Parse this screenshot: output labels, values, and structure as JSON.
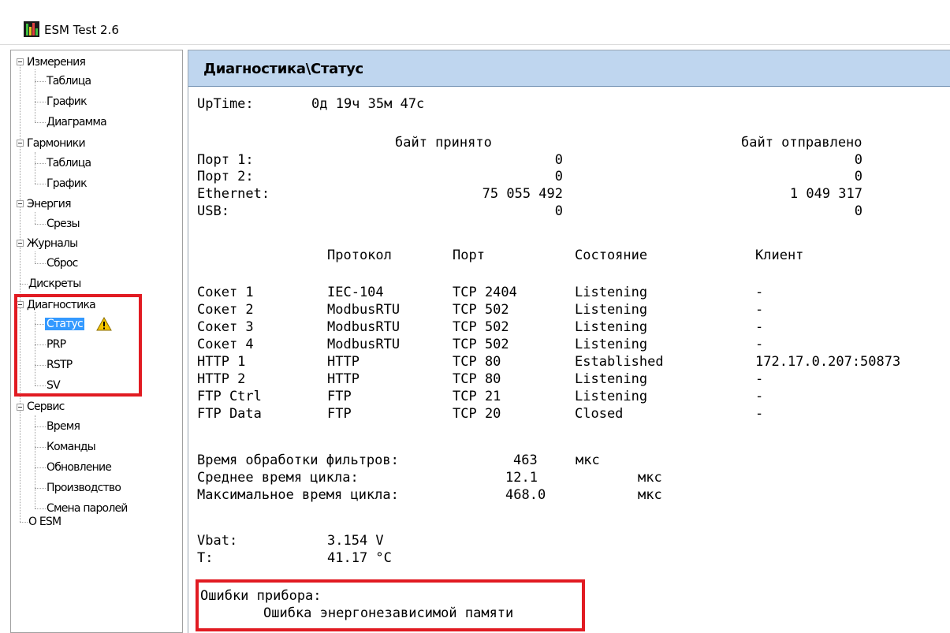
{
  "window": {
    "title": "ESM Test 2.6"
  },
  "tree": {
    "items": [
      {
        "label": "Измерения"
      },
      {
        "label": "Таблица"
      },
      {
        "label": "График"
      },
      {
        "label": "Диаграмма"
      },
      {
        "label": "Гармоники"
      },
      {
        "label": "Таблица"
      },
      {
        "label": "График"
      },
      {
        "label": "Энергия"
      },
      {
        "label": "Срезы"
      },
      {
        "label": "Журналы"
      },
      {
        "label": "Сброс"
      },
      {
        "label": "Дискреты"
      },
      {
        "label": "Диагностика"
      },
      {
        "label": "Статус"
      },
      {
        "label": "PRP"
      },
      {
        "label": "RSTP"
      },
      {
        "label": "SV"
      },
      {
        "label": "Сервис"
      },
      {
        "label": "Время"
      },
      {
        "label": "Команды"
      },
      {
        "label": "Обновление"
      },
      {
        "label": "Производство"
      },
      {
        "label": "Смена паролей"
      },
      {
        "label": "O ESM"
      }
    ]
  },
  "panel": {
    "title": "Диагностика\\Статус",
    "uptime": {
      "label": "UpTime:",
      "value": "0д 19ч 35м 47с"
    },
    "traffic": {
      "header_received": "байт принято",
      "header_sent": "байт отправлено",
      "rows": [
        {
          "name": "Порт 1:",
          "received": "0",
          "sent": "0"
        },
        {
          "name": "Порт 2:",
          "received": "0",
          "sent": "0"
        },
        {
          "name": "Ethernet:",
          "received": "75 055 492",
          "sent": "1 049 317"
        },
        {
          "name": "USB:",
          "received": "0",
          "sent": "0"
        }
      ]
    },
    "sockets": {
      "headers": {
        "protocol": "Протокол",
        "port": "Порт",
        "state": "Состояние",
        "client": "Клиент"
      },
      "rows": [
        {
          "name": "Сокет 1",
          "protocol": "IEC-104",
          "port": "TCP 2404",
          "state": "Listening",
          "client": "-"
        },
        {
          "name": "Сокет 2",
          "protocol": "ModbusRTU",
          "port": "TCP 502",
          "state": "Listening",
          "client": "-"
        },
        {
          "name": "Сокет 3",
          "protocol": "ModbusRTU",
          "port": "TCP 502",
          "state": "Listening",
          "client": "-"
        },
        {
          "name": "Сокет 4",
          "protocol": "ModbusRTU",
          "port": "TCP 502",
          "state": "Listening",
          "client": "-"
        },
        {
          "name": "HTTP 1",
          "protocol": "HTTP",
          "port": "TCP 80",
          "state": "Established",
          "client": "172.17.0.207:50873"
        },
        {
          "name": "HTTP 2",
          "protocol": "HTTP",
          "port": "TCP 80",
          "state": "Listening",
          "client": "-"
        },
        {
          "name": "FTP Ctrl",
          "protocol": "FTP",
          "port": "TCP 21",
          "state": "Listening",
          "client": "-"
        },
        {
          "name": "FTP Data",
          "protocol": "FTP",
          "port": "TCP 20",
          "state": "Closed",
          "client": "-"
        }
      ]
    },
    "timing": [
      {
        "label": "Время обработки фильтров:",
        "value": "463",
        "unit": "мкс"
      },
      {
        "label": "Среднее время цикла:",
        "value": "12.1",
        "unit": "мкс"
      },
      {
        "label": "Максимальное время цикла:",
        "value": "468.0",
        "unit": "мкс"
      }
    ],
    "sensors": [
      {
        "label": "Vbat:",
        "value": "3.154 V"
      },
      {
        "label": "T:",
        "value": "41.17 °C"
      }
    ],
    "errors": {
      "label": "Ошибки прибора:",
      "message": "Ошибка энергонезависимой памяти"
    }
  },
  "colors": {
    "highlight": "#e11b22",
    "selection": "#3399ff",
    "header_bg": "#bfd6ef",
    "warning": "#f5c400"
  },
  "icons": [
    "app-logo-icon",
    "collapse-minus-icon",
    "warning-icon"
  ]
}
